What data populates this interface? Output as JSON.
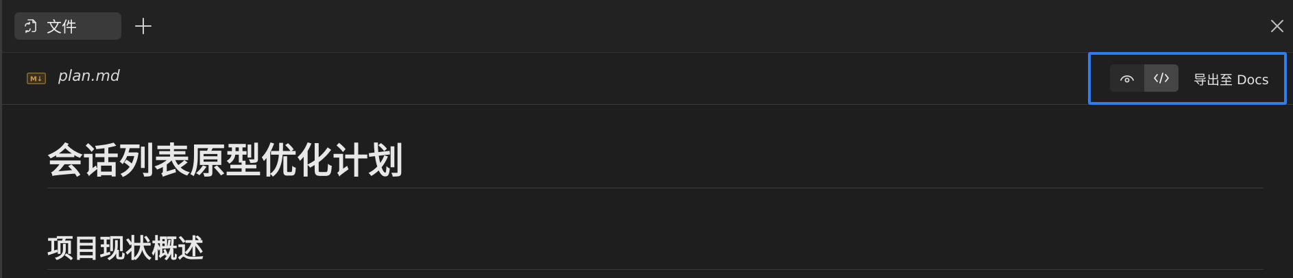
{
  "tabs": [
    {
      "label": "文件",
      "icon": "file-sync-icon"
    }
  ],
  "tabbar": {
    "add_icon": "plus-icon",
    "close_icon": "close-icon"
  },
  "file": {
    "name": "plan.md",
    "type_icon": "markdown-icon",
    "type_badge": "M↓"
  },
  "toolbar": {
    "preview_icon": "eye-icon",
    "source_icon": "code-icon",
    "export_label": "导出至 Docs",
    "highlight_color": "#2f7ef0"
  },
  "document": {
    "h1": "会话列表原型优化计划",
    "h2": "项目现状概述"
  }
}
